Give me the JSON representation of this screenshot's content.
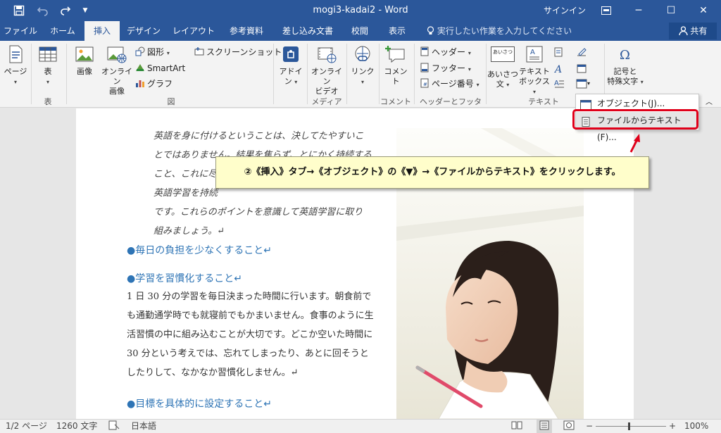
{
  "window": {
    "title": "mogi3-kadai2  -  Word",
    "signin": "サインイン",
    "minimize": "─",
    "restore": "☐",
    "close": "✕"
  },
  "quick_access": {
    "save_icon": "save-icon",
    "undo_icon": "undo-icon",
    "redo_icon": "redo-icon",
    "customize": "▼"
  },
  "tabs": [
    {
      "label": "ファイル"
    },
    {
      "label": "ホーム"
    },
    {
      "label": "挿入",
      "active": true
    },
    {
      "label": "デザイン"
    },
    {
      "label": "レイアウト"
    },
    {
      "label": "参考資料"
    },
    {
      "label": "差し込み文書"
    },
    {
      "label": "校閲"
    },
    {
      "label": "表示"
    }
  ],
  "tellme": "実行したい作業を入力してください",
  "share": "共有",
  "ribbon": {
    "page_btn": "ページ",
    "table_btn": "表",
    "picture_btn": "画像",
    "online_picture_btn": [
      "オンライン",
      "画像"
    ],
    "shapes_btn": "図形",
    "smartart_btn": "SmartArt",
    "chart_btn": "グラフ",
    "screenshot_btn": "スクリーンショット",
    "addin_btn": [
      "アドイ",
      "ン"
    ],
    "online_video_btn": [
      "オンライン",
      "ビデオ"
    ],
    "link_btn": "リンク",
    "comment_btn": "コメント",
    "header_btn": "ヘッダー",
    "footer_btn": "フッター",
    "page_number_btn": "ページ番号",
    "greeting_btn": [
      "あいさつ",
      "文"
    ],
    "greeting_icon_text": "あいさつ",
    "textbox_btn": [
      "テキスト",
      "ボックス"
    ],
    "symbol_btn": [
      "記号と",
      "特殊文字"
    ],
    "groups": {
      "table": "表",
      "illustrations": "図",
      "media": "メディア",
      "comments": "コメント",
      "header_footer": "ヘッダーとフッター",
      "text": "テキスト"
    }
  },
  "object_menu": {
    "items": [
      {
        "label": "オブジェクト(J)..."
      },
      {
        "label": "ファイルからテキスト(F)..."
      }
    ]
  },
  "document": {
    "quote_lines": [
      "英語を身に付けるということは、決してたやすいこ",
      "とではありません。結果を焦らず、とにかく持続する",
      "こと、これに尽",
      "英語学習を持続",
      "です。これらのポイントを意識して英語学習に取り",
      "組みましょう。↵"
    ],
    "heading1": "●毎日の負担を少なくすること↵",
    "heading2": "●学習を習慣化すること↵",
    "body_lines": [
      "1 日 30 分の学習を毎日決まった時間に行います。朝食前で",
      "も通勤通学時でも就寝前でもかまいません。食事のように生",
      "活習慣の中に組み込むことが大切です。どこか空いた時間に",
      "30 分という考えでは、忘れてしまったり、あとに回そうと",
      "したりして、なかなか習慣化しません。↵"
    ],
    "heading3": "●目標を具体的に設定すること↵"
  },
  "callout": "②《挿入》タブ→《オブジェクト》の《▼》→《ファイルからテキスト》をクリックします。",
  "status": {
    "page": "1/2 ページ",
    "words": "1260 文字",
    "language": "日本語",
    "zoom": "100%"
  },
  "colors": {
    "title_bar": "#2b579a",
    "highlight": "#e0001a",
    "heading": "#2e74b5",
    "callout_bg": "#fffecb"
  }
}
